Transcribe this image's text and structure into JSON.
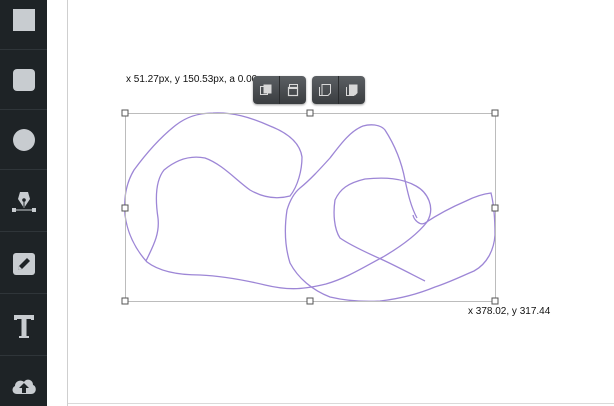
{
  "toolbar": {
    "tools": [
      {
        "name": "rectangle-tool",
        "icon": "square-icon"
      },
      {
        "name": "rounded-rectangle-tool",
        "icon": "rounded-square-icon"
      },
      {
        "name": "ellipse-tool",
        "icon": "circle-icon"
      },
      {
        "name": "pen-tool",
        "icon": "pen-nib-icon"
      },
      {
        "name": "pencil-tool",
        "icon": "pencil-icon"
      },
      {
        "name": "text-tool",
        "icon": "text-T-icon"
      },
      {
        "name": "upload-tool",
        "icon": "cloud-upload-icon"
      }
    ]
  },
  "selection": {
    "top_readout": "x 51.27px, y 150.53px, a 0.00",
    "bottom_readout": "x 378.02, y 317.44"
  },
  "float_toolbar": {
    "buttons": [
      {
        "name": "bring-forward-button",
        "icon": "layer-forward-icon"
      },
      {
        "name": "send-backward-button",
        "icon": "layer-backward-icon"
      },
      {
        "name": "duplicate-button",
        "icon": "copy-icon"
      },
      {
        "name": "paste-button",
        "icon": "paste-icon"
      }
    ]
  },
  "colors": {
    "toolbar_bg": "#1e2326",
    "tool_icon": "#c8ccd0",
    "stroke": "#9d86d6",
    "selection_border": "#bcbcbc"
  }
}
